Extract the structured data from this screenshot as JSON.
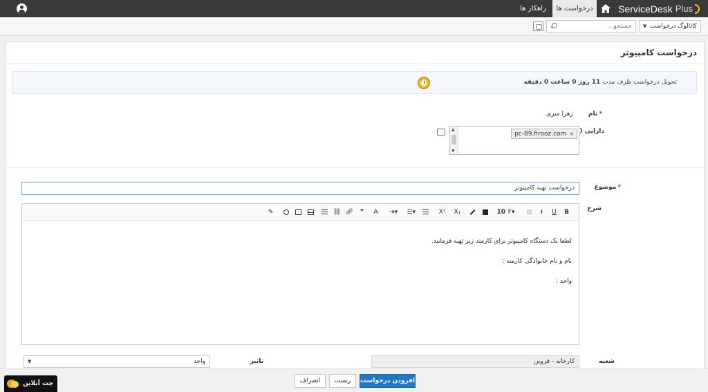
{
  "app": {
    "brand_name": "ServiceDesk",
    "brand_suffix": "Plus",
    "tabs": [
      {
        "label": "درخواست ها",
        "active": true
      },
      {
        "label": "راهکار ها",
        "active": false
      }
    ]
  },
  "searchbar": {
    "catalog_label": "کاتالوگ درخواست",
    "search_placeholder": "جستجو..."
  },
  "page": {
    "title": "درخواست کامپیوتر",
    "sla_prefix": "تحویل درخواست ظرف مدت",
    "sla_duration": "11 روز 0 ساعت 0 دقیقه"
  },
  "form": {
    "name_label": "نام",
    "name_value": "زهرا میری",
    "assets_label": "دارایی (ها)",
    "asset_chip": "pc-89.firooz.com",
    "subject_label": "موضوع",
    "subject_value": "درخواست تهیه کامپیوتر",
    "description_label": "شرح",
    "description_lines": [
      "لطفا یک دستگاه کامپیوتر برای کارمند زیر تهیه فرمایید.",
      "نام و نام خانوادگی کارمند :",
      "واحد :"
    ],
    "branch_label": "شعبه",
    "branch_value": "کارخانه - قزوین",
    "impact_label": "تاثیر",
    "impact_value": "واحد"
  },
  "toolbar": {
    "bold": "B",
    "underline": "U",
    "strike": "I",
    "font_size": "10",
    "font_btn": "F"
  },
  "footer": {
    "submit_label": "افزودن درخواست",
    "reset_label": "ریست",
    "cancel_label": "انصراف"
  },
  "chat": {
    "label": "چت آنلاین"
  },
  "colors": {
    "topbar": "#3a3a3a",
    "primary": "#1e78c8",
    "required": "#dd3333",
    "sla_bg": "#f2f8fc"
  }
}
